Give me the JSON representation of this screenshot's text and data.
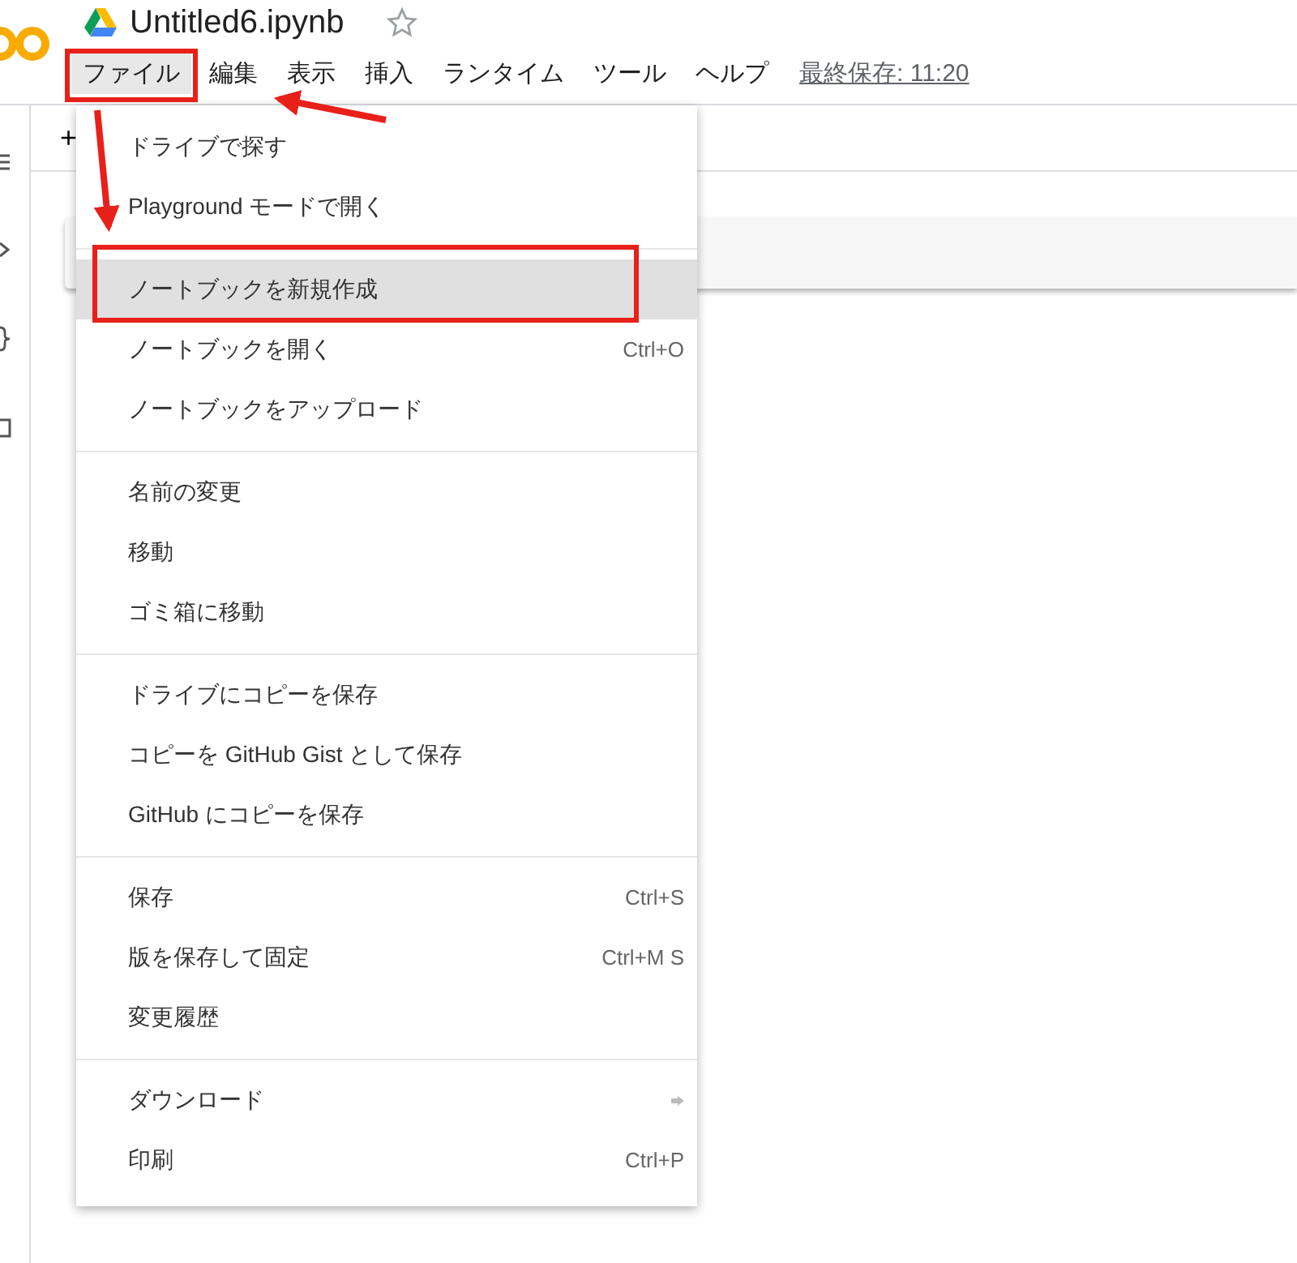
{
  "header": {
    "title": "Untitled6.ipynb",
    "starred": false,
    "last_saved": "最終保存: 11:20"
  },
  "menubar": [
    {
      "label": "ファイル",
      "selected": true
    },
    {
      "label": "編集",
      "selected": false
    },
    {
      "label": "表示",
      "selected": false
    },
    {
      "label": "挿入",
      "selected": false
    },
    {
      "label": "ランタイム",
      "selected": false
    },
    {
      "label": "ツール",
      "selected": false
    },
    {
      "label": "ヘルプ",
      "selected": false
    }
  ],
  "toolbar": {
    "add_label": "+"
  },
  "file_menu": [
    [
      {
        "label": "ドライブで探す",
        "selected": false,
        "submenu": false
      },
      {
        "label": "Playground モードで開く",
        "selected": false,
        "submenu": false
      }
    ],
    [
      {
        "label": "ノートブックを新規作成",
        "selected": true,
        "submenu": false
      },
      {
        "label": "ノートブックを開く",
        "shortcut": "Ctrl+O",
        "selected": false,
        "submenu": false
      },
      {
        "label": "ノートブックをアップロード",
        "selected": false,
        "submenu": false
      }
    ],
    [
      {
        "label": "名前の変更",
        "selected": false,
        "submenu": false
      },
      {
        "label": "移動",
        "selected": false,
        "submenu": false
      },
      {
        "label": "ゴミ箱に移動",
        "selected": false,
        "submenu": false
      }
    ],
    [
      {
        "label": "ドライブにコピーを保存",
        "selected": false,
        "submenu": false
      },
      {
        "label": "コピーを GitHub Gist として保存",
        "selected": false,
        "submenu": false
      },
      {
        "label": "GitHub にコピーを保存",
        "selected": false,
        "submenu": false
      }
    ],
    [
      {
        "label": "保存",
        "shortcut": "Ctrl+S",
        "selected": false,
        "submenu": false
      },
      {
        "label": "版を保存して固定",
        "shortcut": "Ctrl+M S",
        "selected": false,
        "submenu": false
      },
      {
        "label": "変更履歴",
        "selected": false,
        "submenu": false
      }
    ],
    [
      {
        "label": "ダウンロード",
        "selected": false,
        "submenu": true
      },
      {
        "label": "印刷",
        "shortcut": "Ctrl+P",
        "selected": false,
        "submenu": false
      }
    ]
  ]
}
